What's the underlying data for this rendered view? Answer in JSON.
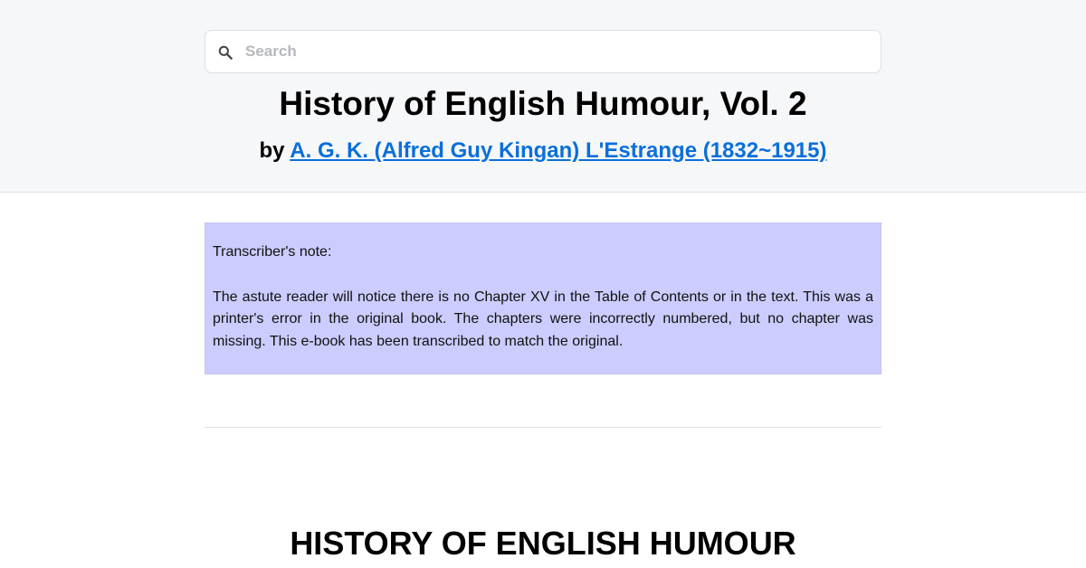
{
  "search": {
    "placeholder": "Search",
    "value": ""
  },
  "book": {
    "title": "History of English Humour, Vol. 2",
    "by_label": "by",
    "author": "A. G. K. (Alfred Guy Kingan) L'Estrange (1832~1915)"
  },
  "note": {
    "heading": "Transcriber's note:",
    "body": "The astute reader will notice there is no Chapter XV in the Table of Contents or in the text. This was a printer's error in the original book. The chapters were incorrectly numbered, but no chapter was missing. This e-book has been transcribed to match the original."
  },
  "content": {
    "heading": "HISTORY OF ENGLISH HUMOUR"
  },
  "colors": {
    "header_bg": "#f6f7f9",
    "link": "#0a6fdb",
    "note_bg": "#ccccff"
  }
}
